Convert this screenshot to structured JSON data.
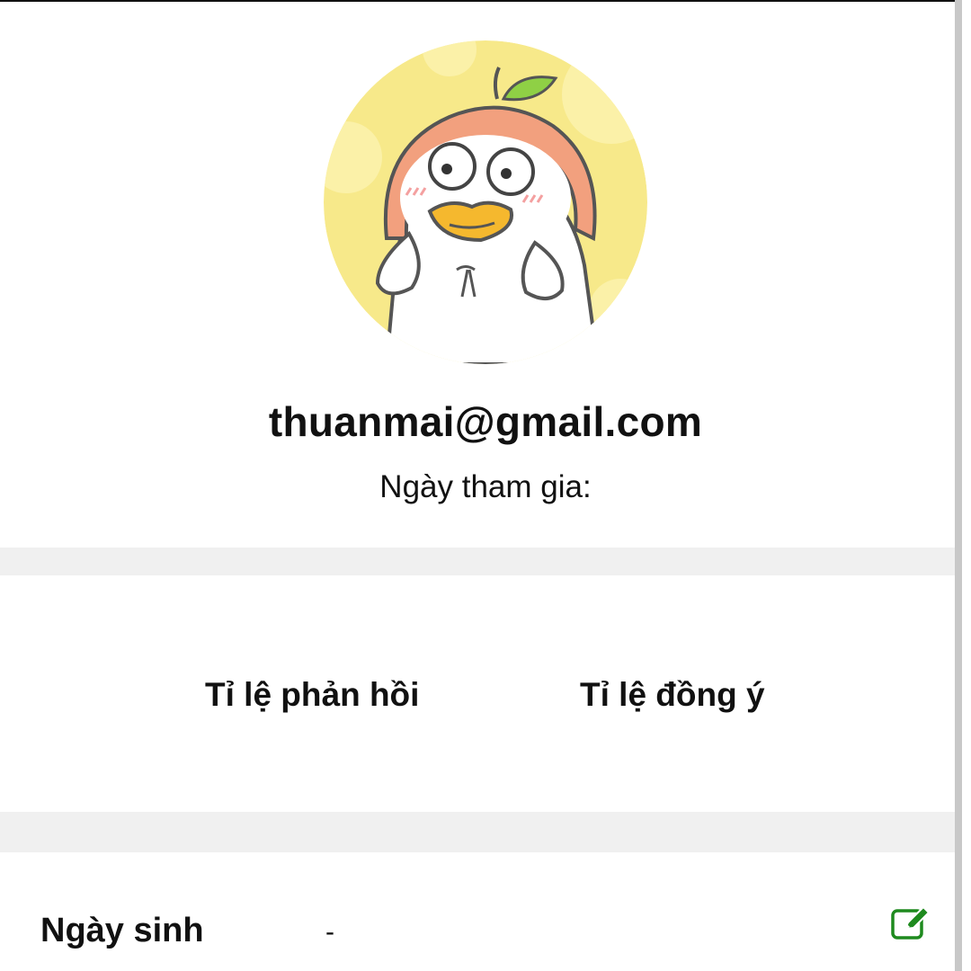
{
  "profile": {
    "email": "thuanmai@gmail.com",
    "joined_label": "Ngày tham gia:"
  },
  "stats": {
    "reply_rate_label": "Tỉ lệ phản hồi",
    "agree_rate_label": "Tỉ lệ đồng ý"
  },
  "info": {
    "birthday_label": "Ngày sinh",
    "birthday_value": "-"
  },
  "icons": {
    "avatar": "duck-peach-hat-avatar",
    "edit": "edit-icon"
  },
  "colors": {
    "accent_green": "#1e8a1e",
    "separator": "#f0f0f0",
    "avatar_bg": "#f7e98a"
  }
}
